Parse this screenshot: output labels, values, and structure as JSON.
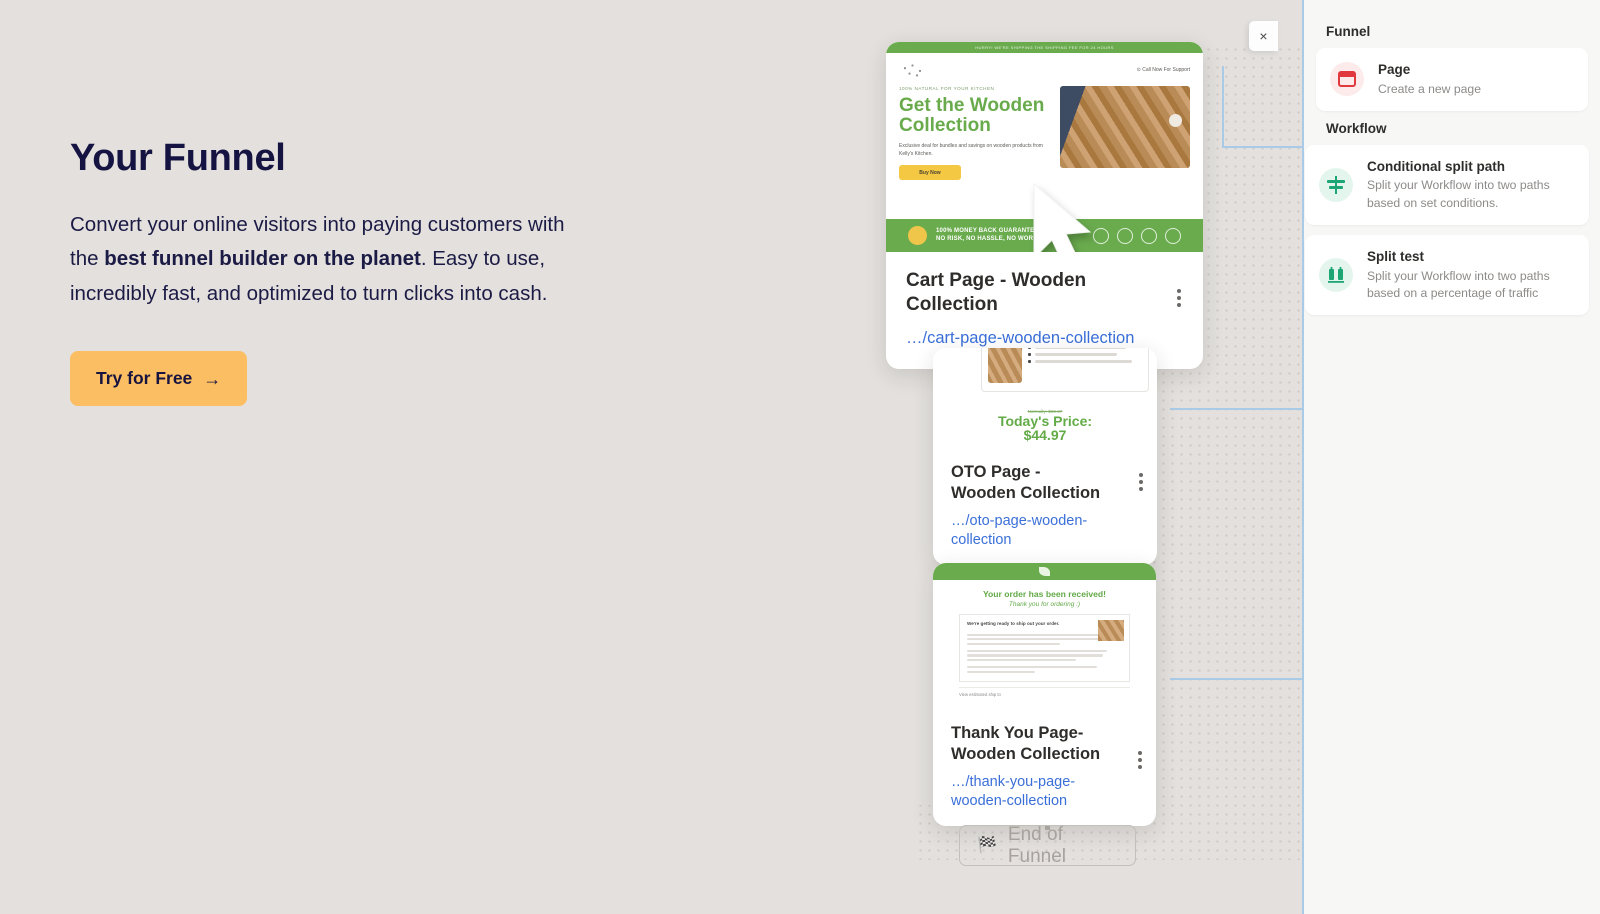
{
  "hero": {
    "title": "Your Funnel",
    "body_part1": "Convert your online visitors into paying customers with the ",
    "body_bold": "best funnel builder on the planet",
    "body_part2": ". Easy to use, incredibly fast, and optimized to turn clicks into cash.",
    "cta_label": "Try for Free",
    "cta_arrow": "→",
    "accent_color": "#fcbe63",
    "title_color": "#151341"
  },
  "canvas": {
    "close_button_label": "×",
    "end_of_funnel_label": "End of Funnel",
    "end_of_funnel_icon": "checkered-flag-icon",
    "background_color": "#e3e0dd",
    "connector_color": "#b5b0ac",
    "link_color": "#a9cbe8"
  },
  "nodes": [
    {
      "id": "cart",
      "title": "Cart Page - Wooden Collection",
      "url": "…/cart-page-wooden-collection",
      "menu_icon": "kebab-menu-icon",
      "preview": {
        "announcement": "HURRY! WE'RE SHIPPING THE SHIPPING FEE FOR 24 HOURS",
        "support": "⊙ Call Now For Support",
        "eyebrow": "100% NATURAL FOR YOUR KITCHEN",
        "headline": "Get the Wooden Collection",
        "subtext": "Exclusive deal for bundles and savings on wooden products from Kelly's Kitchen.",
        "button": "Buy Now",
        "guarantee_line1": "100% MONEY BACK GUARANTEE",
        "guarantee_line2": "NO RISK, NO HASSLE, NO WORRY"
      }
    },
    {
      "id": "oto",
      "title": "OTO Page - Wooden Collection",
      "url": "…/oto-page-wooden-collection",
      "menu_icon": "kebab-menu-icon",
      "preview": {
        "normally": "Normally: $89.97",
        "price_label": "Today's Price:",
        "price_value": "$44.97"
      }
    },
    {
      "id": "thankyou",
      "title": "Thank You Page- Wooden Collection",
      "url": "…/thank-you-page-wooden-collection",
      "menu_icon": "kebab-menu-icon",
      "preview": {
        "headline": "Your order has been received!",
        "subhead": "Thank you for ordering :)",
        "panel_title": "We're getting ready to ship out your order.",
        "footer": "View estimated ship to"
      }
    }
  ],
  "sidebar": {
    "sections": [
      {
        "label": "Funnel"
      },
      {
        "label": "Workflow"
      }
    ],
    "funnel_items": [
      {
        "name": "Page",
        "desc": "Create a new page",
        "icon": "page-window-icon",
        "icon_color": "#e0383c"
      }
    ],
    "workflow_items": [
      {
        "name": "Conditional split path",
        "desc": "Split your Workflow into two paths based on set conditions.",
        "icon": "signpost-icon",
        "icon_color": "#1da574"
      },
      {
        "name": "Split test",
        "desc": "Split your Workflow into two paths based on a percentage of traffic",
        "icon": "split-test-icon",
        "icon_color": "#1da574"
      }
    ]
  }
}
